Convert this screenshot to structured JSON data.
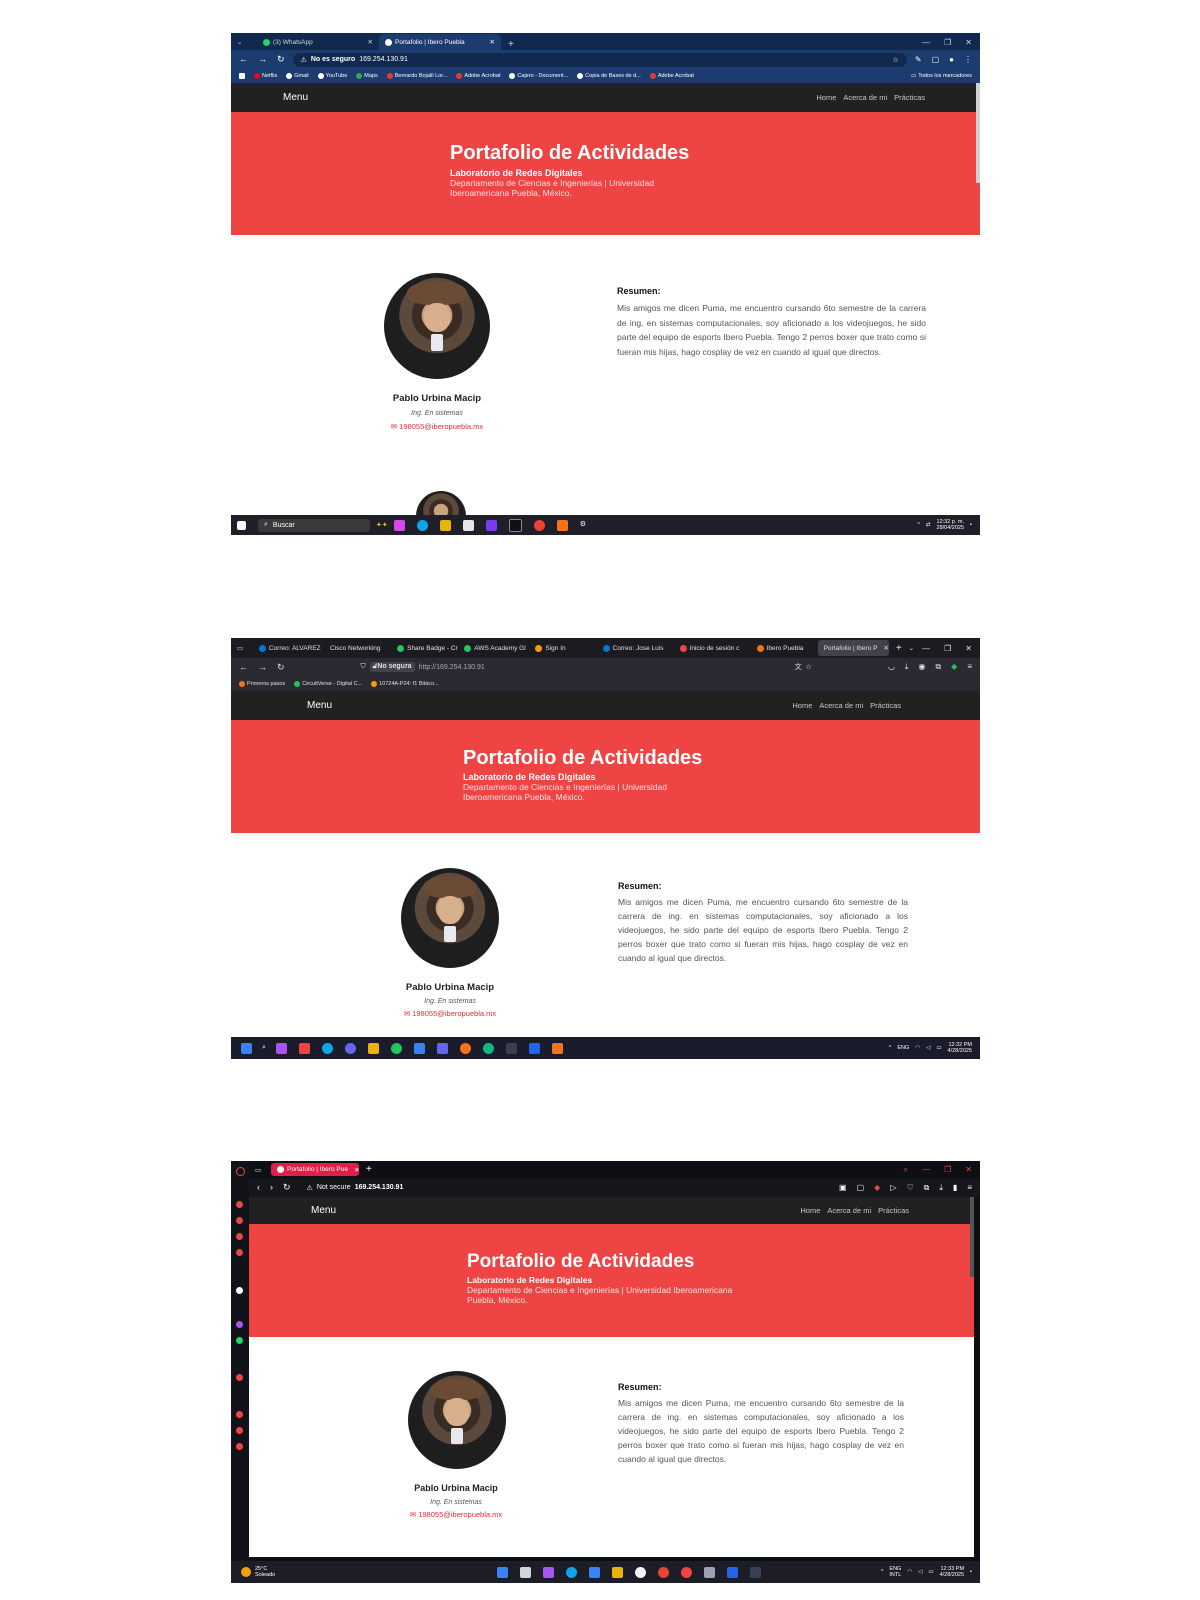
{
  "site": {
    "brand": "Menu",
    "nav": [
      "Home",
      "Acerca de mi",
      "Prácticas"
    ],
    "hero_title": "Portafolio de Actividades",
    "hero_subtitle": "Laboratorio de Redes Digitales",
    "hero_dept_line1": "Departamento de Ciencias e Ingenierías | Universidad",
    "hero_dept_line2": "Iberoamericana Puebla, México.",
    "hero_dept_line1_b": "Departamento de Ciencias e Ingenierías | Universidad Iberoamericana",
    "hero_dept_line2_b": "Puebla, México.",
    "profile_name": "Pablo Urbina Macip",
    "profile_role": "Ing. En sistemas",
    "profile_email": "198055@iberopuebla.mx",
    "summary_title": "Resumen:",
    "summary_text": "Mis amigos me dicen Puma, me encuentro cursando 6to semestre de la carrera de ing. en sistemas computacionales, soy aficionado a los videojuegos, he sido parte del equipo de esports Ibero Puebla. Tengo 2 perros boxer que trato como si fueran mis hijas, hago cosplay de vez en cuando al igual que directos."
  },
  "shot1": {
    "tabs": [
      {
        "label": "(3) WhatsApp",
        "icon": "whatsapp-icon",
        "color": "#25d366"
      },
      {
        "label": "Portafolio | Ibero Puebla",
        "icon": "globe-icon",
        "color": "#ffffff"
      }
    ],
    "secure_label": "No es seguro",
    "url": "169.254.130.91",
    "bookmarks": [
      "Netflix",
      "Gmail",
      "YouTube",
      "Maps",
      "Bernardo Bojalil Lor...",
      "Adobe Acrobat",
      "Cajero - Document...",
      "Copia de Bases de d...",
      "Adobe Acrobat"
    ],
    "bookmarks_all": "Todos los marcadores",
    "search_placeholder": "Buscar",
    "time": "12:32 p. m.",
    "date": "28/04/2025"
  },
  "shot2": {
    "tabs": [
      "Correo: ALVAREZ",
      "Cisco Networking",
      "Share Badge - Cr",
      "AWS Academy Gl",
      "Sign In",
      "Correo: Jose Luis",
      "Inicio de sesión c",
      "Ibero Puebla",
      "Portafolio | Ibero P"
    ],
    "secure_label": "No segura",
    "url": "http://169.254.130.91",
    "bookmarks": [
      "Primeros pasos",
      "CircuitVerse - Digital C...",
      "10724A-P24: f1 Bitáco..."
    ],
    "lang": "ENG",
    "time": "12:32 PM",
    "date": "4/28/2025"
  },
  "shot3": {
    "tabs": [
      "Portafolio | Ibero Pue"
    ],
    "secure_label": "Not secure",
    "url": "169.254.130.91",
    "weather_temp": "25°C",
    "weather_desc": "Soleado",
    "lang1": "ENG",
    "lang2": "INTL",
    "time": "12:33 PM",
    "date": "4/28/2025"
  },
  "colors": {
    "accent": "#ef4444",
    "nav": "#212121",
    "chrome_blue": "#1c3b6e",
    "edge_dark": "#1f1f1f",
    "opera_dark": "#111318"
  }
}
